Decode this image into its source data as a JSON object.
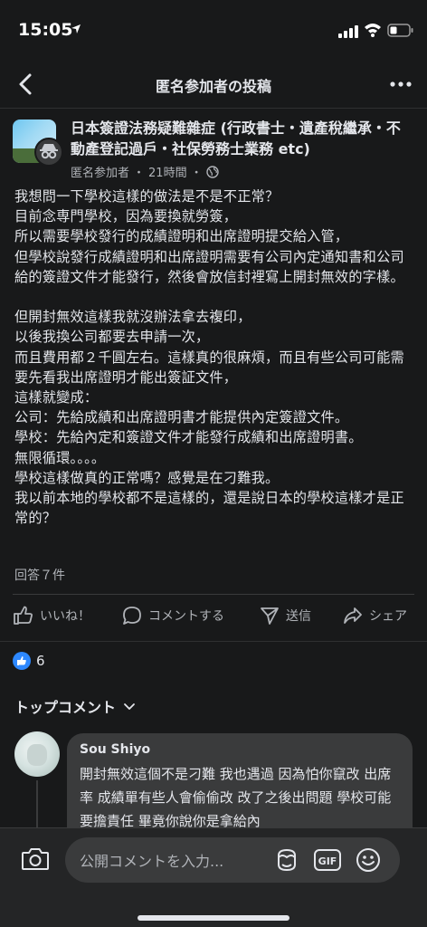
{
  "status_bar": {
    "time": "15:05"
  },
  "nav": {
    "title": "匿名参加者の投稿"
  },
  "post": {
    "group_name": "日本簽證法務疑難雜症 (行政書士・遺產稅繼承・不動產登記過戶・社保勞務士業務 etc)",
    "author": "匿名参加者",
    "time_sep": "・",
    "time": "21時間",
    "time_sep2": "・",
    "body": "我想問一下學校這樣的做法是不是不正常？\n目前念専門學校，因為要換就勞簽，\n所以需要學校發行的成績證明和出席證明提交給入管，\n但學校說發行成績證明和出席證明需要有公司內定通知書和公司給的簽證文件才能發行，然後會放信封裡寫上開封無效的字樣。\n\n但開封無效這樣我就沒辦法拿去複印，\n以後我換公司都要去申請一次，\n而且費用都２千圓左右。這樣真的很麻煩，而且有些公司可能需要先看我出席證明才能出簽証文件，\n這樣就變成：\n公司：先給成績和出席證明書才能提供內定簽證文件。\n學校：先給內定和簽證文件才能發行成績和出席證明書。\n無限循環。。。。\n學校這樣做真的正常嗎？感覺是在刁難我。\n我以前本地的學校都不是這樣的，還是說日本的學校這樣才是正常的？",
    "answers": "回答７件"
  },
  "actions": {
    "like": "いいね！",
    "comment": "コメントする",
    "send": "送信",
    "share": "シェア"
  },
  "reactions": {
    "count": "6"
  },
  "comments_section": {
    "header": "トップコメント"
  },
  "comment": {
    "author": "Sou Shiyo",
    "text": "開封無效這個不是刁難 我也遇過 因為怕你竄改 出席率 成績單有些人會偷偷改 改了之後出問題 學校可能要擔責任 畢竟你說你是拿給內"
  },
  "compose": {
    "placeholder": "公開コメントを入力..."
  },
  "colors": {
    "background": "#18191a",
    "accent": "#2d88ff",
    "bubble": "#3a3b3c"
  }
}
